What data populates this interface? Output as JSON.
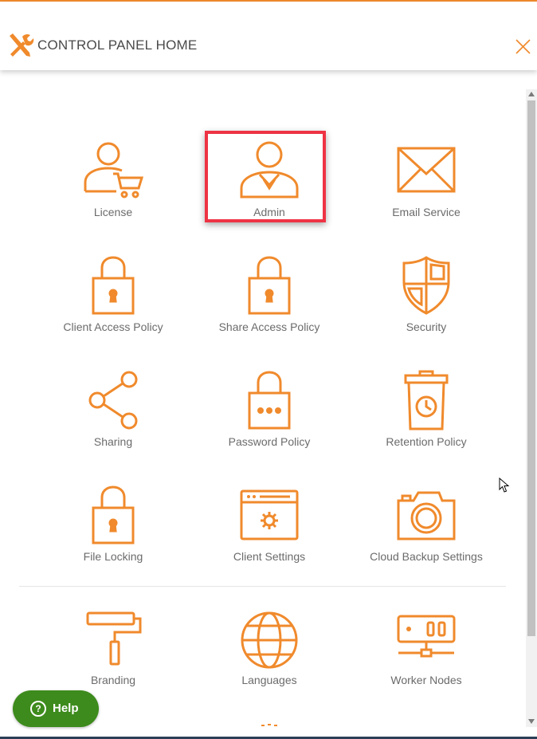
{
  "header": {
    "title": "CONTROL PANEL HOME"
  },
  "tiles": [
    {
      "label": "License"
    },
    {
      "label": "Admin"
    },
    {
      "label": "Email Service"
    },
    {
      "label": "Client Access Policy"
    },
    {
      "label": "Share Access Policy"
    },
    {
      "label": "Security"
    },
    {
      "label": "Sharing"
    },
    {
      "label": "Password Policy"
    },
    {
      "label": "Retention Policy"
    },
    {
      "label": "File Locking"
    },
    {
      "label": "Client Settings"
    },
    {
      "label": "Cloud Backup Settings"
    },
    {
      "label": "Branding"
    },
    {
      "label": "Languages"
    },
    {
      "label": "Worker Nodes"
    }
  ],
  "help": {
    "label": "Help"
  },
  "colors": {
    "accent": "#f08a2c",
    "highlight": "#ee3344",
    "help_bg": "#3d8b1c",
    "text": "#6b6b6b"
  }
}
